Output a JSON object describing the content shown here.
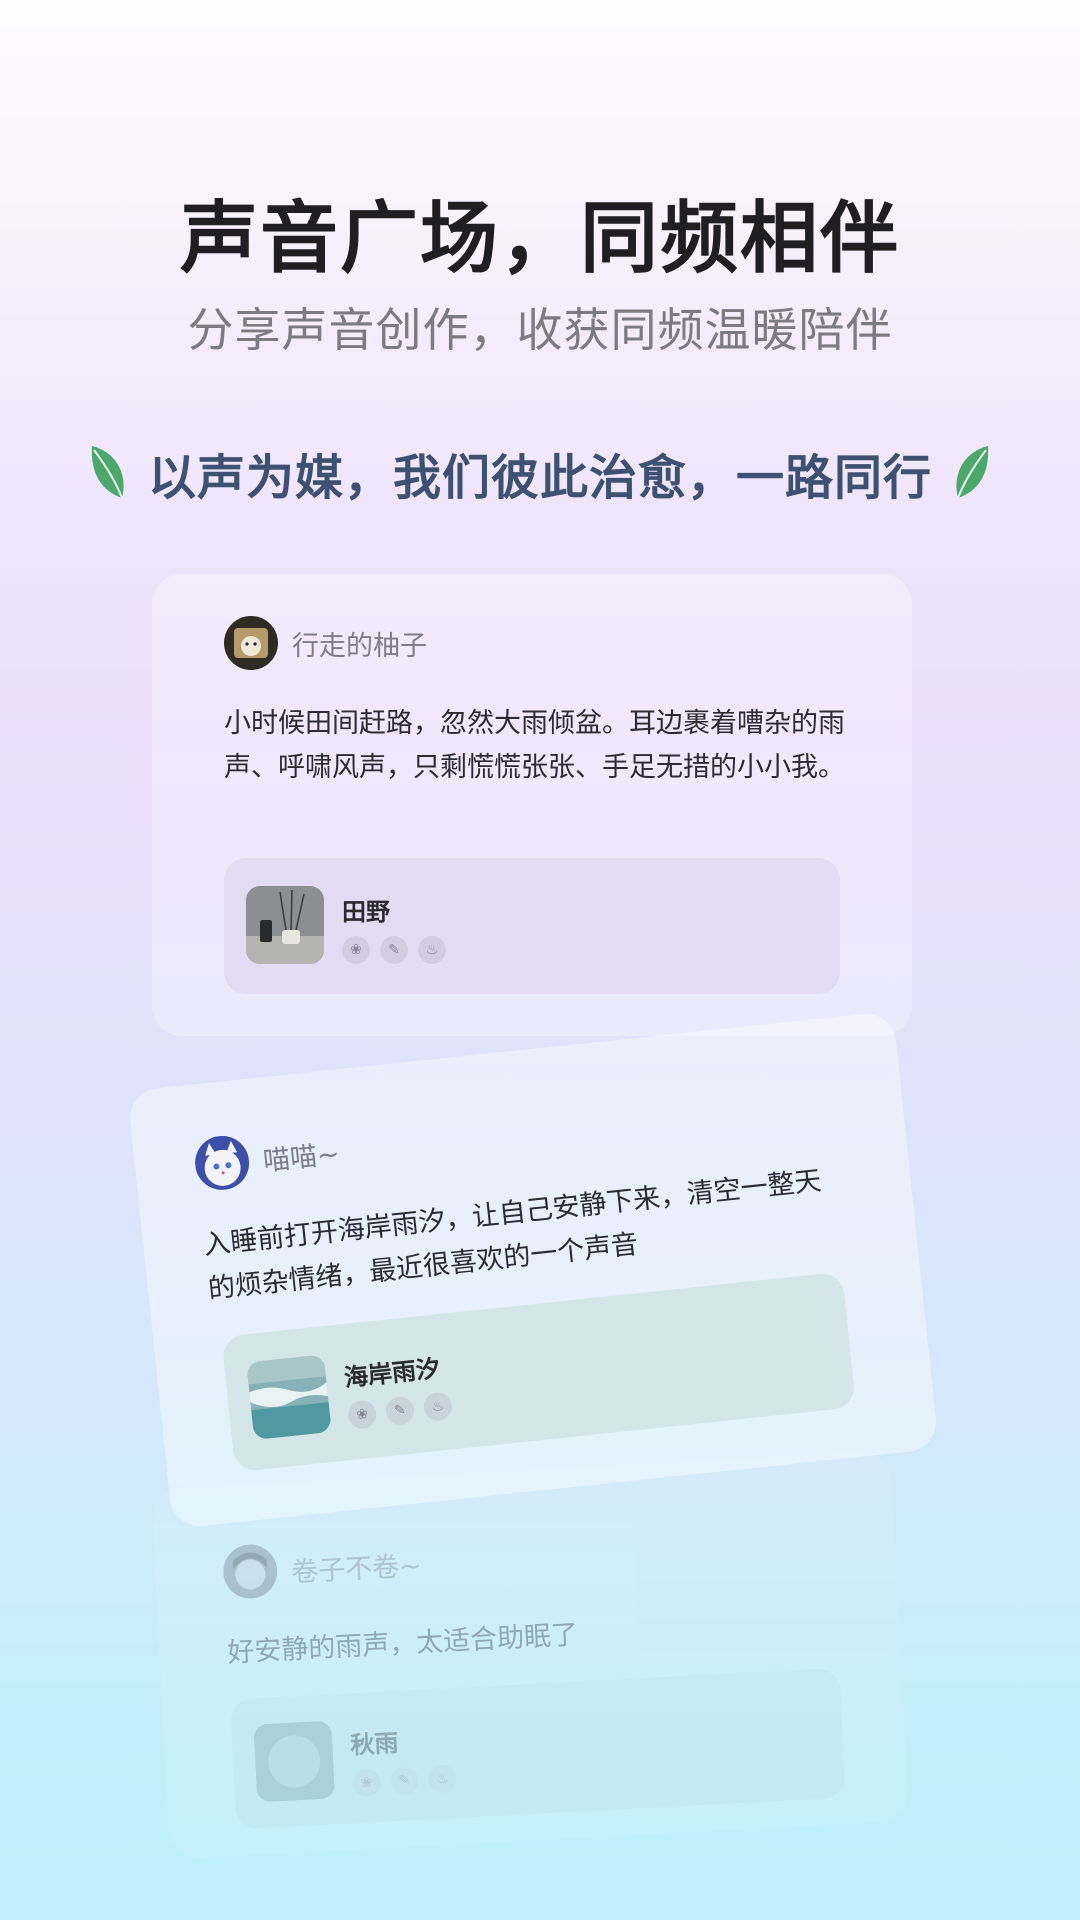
{
  "header": {
    "title": "声音广场，同频相伴",
    "subtitle": "分享声音创作，收获同频温暖陪伴",
    "slogan": "以声为媒，我们彼此治愈，一路同行",
    "leaf_icon": "leaf-icon",
    "leaf_color": "#4aa86a"
  },
  "posts": [
    {
      "username": "行走的柚子",
      "text": "小时候田间赶路，忽然大雨倾盆。耳边裹着嘈杂的雨声、呼啸风声，只剩慌慌张张、手足无措的小小我。",
      "sound": {
        "title": "田野",
        "icons": [
          "leaf-icon",
          "feather-icon",
          "flame-icon"
        ]
      },
      "sound_box_color": "#e4dcf5"
    },
    {
      "username": "喵喵~",
      "text": "入睡前打开海岸雨汐，让自己安静下来，清空一整天的烦杂情绪，最近很喜欢的一个声音",
      "sound": {
        "title": "海岸雨汐",
        "icons": [
          "leaf-icon",
          "feather-icon",
          "flame-icon"
        ]
      },
      "sound_box_color": "#d4e6e8"
    },
    {
      "username": "卷子不卷~",
      "text": "好安静的雨声，太适合助眠了",
      "sound": {
        "title": "秋雨",
        "icons": [
          "leaf-icon",
          "feather-icon",
          "flame-icon"
        ]
      },
      "sound_box_color": "#c8e3ee"
    }
  ]
}
